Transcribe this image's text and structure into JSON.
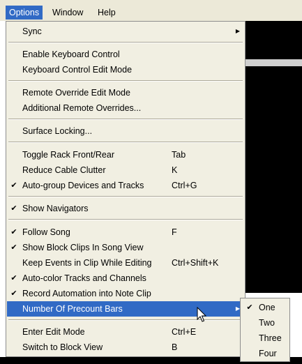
{
  "menubar": {
    "items": [
      {
        "label": "Options",
        "active": true
      },
      {
        "label": "Window",
        "active": false
      },
      {
        "label": "Help",
        "active": false
      }
    ]
  },
  "menu": {
    "items": [
      {
        "label": "Sync",
        "shortcut": "",
        "checked": false,
        "submenu": true
      },
      {
        "label": "Enable Keyboard Control",
        "shortcut": "",
        "checked": false
      },
      {
        "label": "Keyboard Control Edit Mode",
        "shortcut": "",
        "checked": false
      },
      {
        "label": "Remote Override Edit Mode",
        "shortcut": "",
        "checked": false
      },
      {
        "label": "Additional Remote Overrides...",
        "shortcut": "",
        "checked": false
      },
      {
        "label": "Surface Locking...",
        "shortcut": "",
        "checked": false
      },
      {
        "label": "Toggle Rack Front/Rear",
        "shortcut": "Tab",
        "checked": false
      },
      {
        "label": "Reduce Cable Clutter",
        "shortcut": "K",
        "checked": false
      },
      {
        "label": "Auto-group Devices and Tracks",
        "shortcut": "Ctrl+G",
        "checked": true
      },
      {
        "label": "Show Navigators",
        "shortcut": "",
        "checked": true
      },
      {
        "label": "Follow Song",
        "shortcut": "F",
        "checked": true
      },
      {
        "label": "Show Block Clips In Song View",
        "shortcut": "",
        "checked": true
      },
      {
        "label": "Keep Events in Clip While Editing",
        "shortcut": "Ctrl+Shift+K",
        "checked": false
      },
      {
        "label": "Auto-color Tracks and Channels",
        "shortcut": "",
        "checked": true
      },
      {
        "label": "Record Automation into Note Clip",
        "shortcut": "",
        "checked": true
      },
      {
        "label": "Number Of Precount Bars",
        "shortcut": "",
        "checked": false,
        "submenu": true,
        "highlighted": true
      },
      {
        "label": "Enter Edit Mode",
        "shortcut": "Ctrl+E",
        "checked": false
      },
      {
        "label": "Switch to Block View",
        "shortcut": "B",
        "checked": false
      }
    ]
  },
  "submenu": {
    "items": [
      {
        "label": "One",
        "checked": true
      },
      {
        "label": "Two",
        "checked": false
      },
      {
        "label": "Three",
        "checked": false
      },
      {
        "label": "Four",
        "checked": false
      }
    ]
  },
  "icons": {
    "check": "check-icon",
    "submenu_arrow": "submenu-arrow-icon",
    "cursor": "mouse-cursor-icon"
  },
  "colors": {
    "highlight": "#316ac5",
    "menu_bg": "#f1efe2",
    "menubar_bg": "#ece9d8"
  }
}
